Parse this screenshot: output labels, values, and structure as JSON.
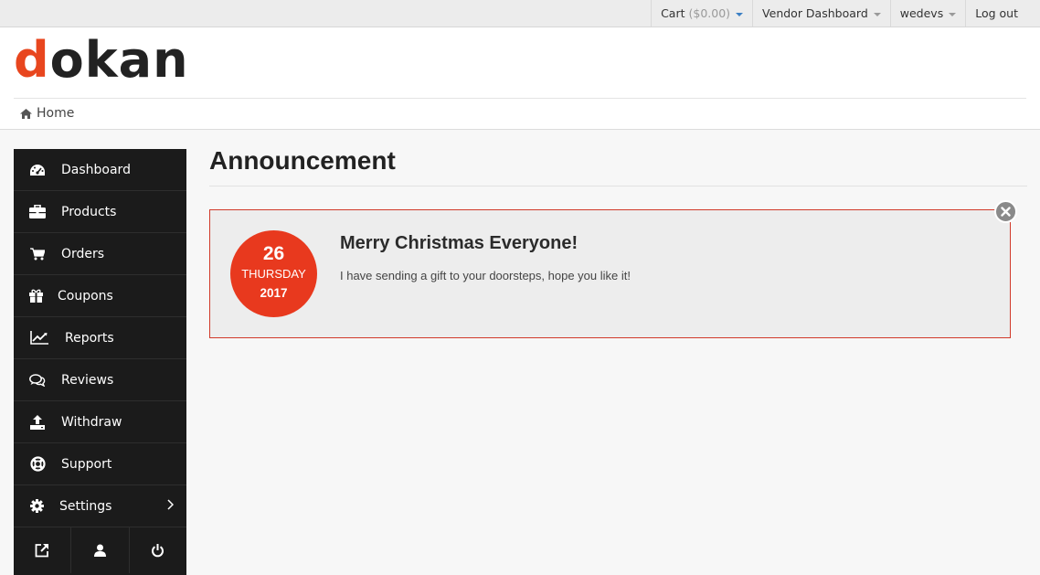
{
  "topnav": {
    "cart_label": "Cart",
    "cart_amount": "($0.00)",
    "vendor_dashboard": "Vendor Dashboard",
    "user": "wedevs",
    "logout": "Log out"
  },
  "brand": {
    "first_letter": "d",
    "rest": "okan"
  },
  "breadcrumb": {
    "home": "Home"
  },
  "sidebar": {
    "items": [
      {
        "label": "Dashboard",
        "icon": "dashboard-icon"
      },
      {
        "label": "Products",
        "icon": "briefcase-icon"
      },
      {
        "label": "Orders",
        "icon": "cart-icon"
      },
      {
        "label": "Coupons",
        "icon": "gift-icon"
      },
      {
        "label": "Reports",
        "icon": "line-chart-icon"
      },
      {
        "label": "Reviews",
        "icon": "comments-icon"
      },
      {
        "label": "Withdraw",
        "icon": "upload-icon"
      },
      {
        "label": "Support",
        "icon": "life-ring-icon"
      },
      {
        "label": "Settings",
        "icon": "gear-icon"
      }
    ],
    "footer_icons": [
      "external-link-icon",
      "user-icon",
      "power-icon"
    ]
  },
  "page": {
    "title": "Announcement"
  },
  "announcement": {
    "day": "26",
    "weekday": "THURSDAY",
    "year": "2017",
    "title": "Merry Christmas Everyone!",
    "body": "I have sending a gift to your doorsteps, hope you like it!"
  },
  "colors": {
    "accent": "#e8391e",
    "sidebar_bg": "#1b1b1b",
    "notice_border": "#d13a2a"
  }
}
